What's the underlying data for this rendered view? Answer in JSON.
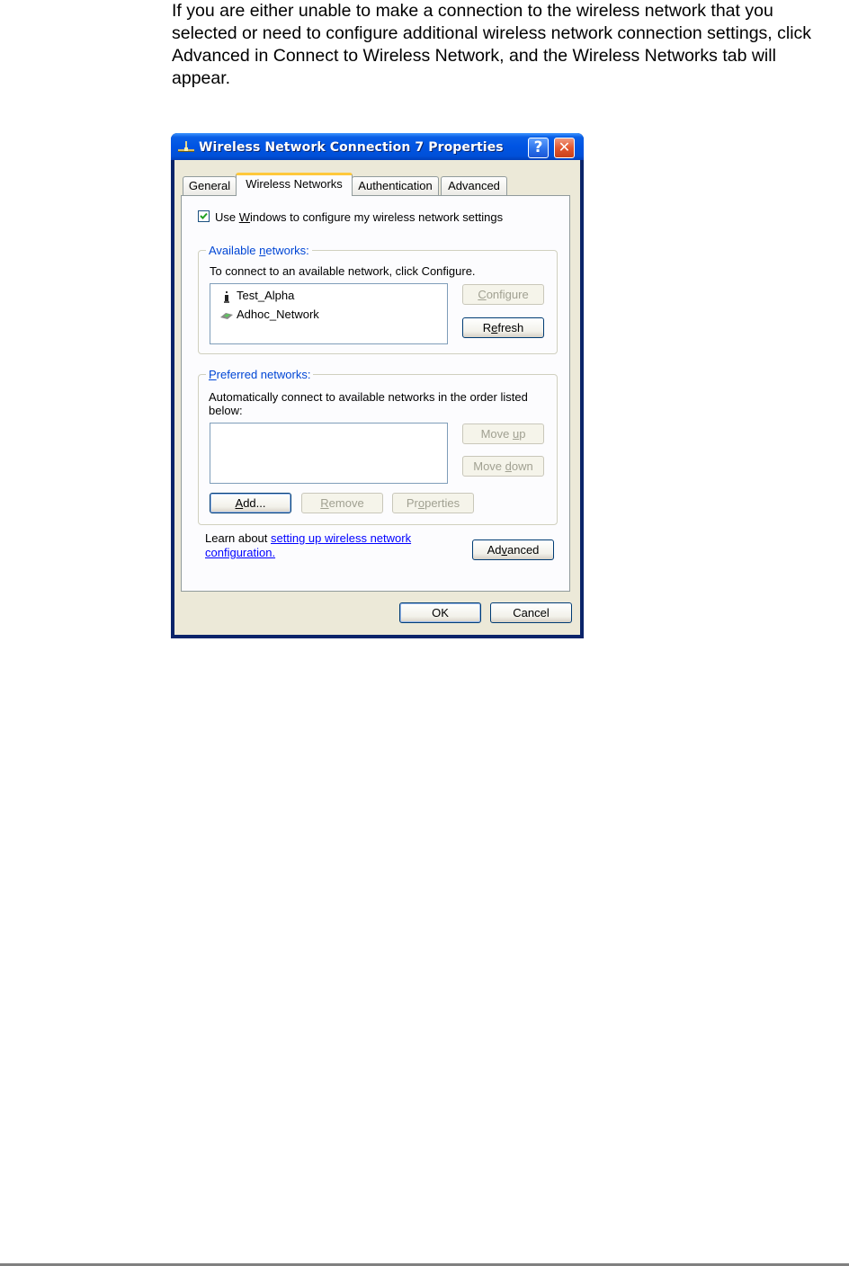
{
  "document": {
    "intro_paragraph": "If you are either unable to make a connection to the wireless network that you selected or need to configure additional wireless network connection settings, click Advanced in Connect to Wireless Network, and the Wireless Networks tab will appear."
  },
  "dialog": {
    "title": "Wireless Network Connection 7 Properties",
    "title_icon": "network-connection-icon",
    "help_button": "?",
    "close_button": "✕",
    "tabs": [
      {
        "label": "General",
        "active": false
      },
      {
        "label": "Wireless Networks",
        "active": true
      },
      {
        "label": "Authentication",
        "active": false
      },
      {
        "label": "Advanced",
        "active": false
      }
    ],
    "use_windows_checkbox": {
      "label_pre": "Use ",
      "label_accel": "W",
      "label_post": "indows to configure my wireless network settings",
      "checked": true
    },
    "available_networks": {
      "legend_pre": "Available ",
      "legend_accel": "n",
      "legend_post": "etworks:",
      "instruction": "To connect to an available network, click Configure.",
      "items": [
        {
          "name": "Test_Alpha",
          "icon": "access-point-icon"
        },
        {
          "name": "Adhoc_Network",
          "icon": "adhoc-network-icon"
        }
      ],
      "configure_button": {
        "accel": "C",
        "rest": "onfigure",
        "enabled": false
      },
      "refresh_button": {
        "pre": "R",
        "accel": "e",
        "rest": "fresh",
        "enabled": true
      }
    },
    "preferred_networks": {
      "legend_accel": "P",
      "legend_post": "referred networks:",
      "instruction": "Automatically connect to available networks in the order listed below:",
      "items": [],
      "move_up_button": {
        "pre": "Move ",
        "accel": "u",
        "rest": "p",
        "enabled": false
      },
      "move_down_button": {
        "pre": "Move ",
        "accel": "d",
        "rest": "own",
        "enabled": false
      },
      "add_button": {
        "accel": "A",
        "rest": "dd...",
        "enabled": true
      },
      "remove_button": {
        "accel": "R",
        "rest": "emove",
        "enabled": false
      },
      "properties_button": {
        "pre": "Pr",
        "accel": "o",
        "rest": "perties",
        "enabled": false
      }
    },
    "learn_about": {
      "prefix": "Learn about ",
      "link_line1": "setting up wireless network",
      "link_line2": "configuration."
    },
    "advanced_button": {
      "pre": "Ad",
      "accel": "v",
      "rest": "anced"
    },
    "ok_button": "OK",
    "cancel_button": "Cancel"
  }
}
